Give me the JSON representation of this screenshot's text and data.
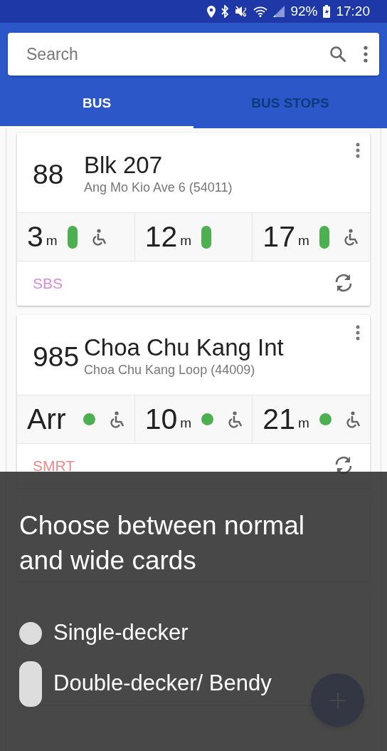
{
  "status_bar": {
    "battery": "92%",
    "time": "17:20"
  },
  "search": {
    "placeholder": "Search"
  },
  "tabs": [
    {
      "label": "BUS",
      "selected": true
    },
    {
      "label": "BUS STOPS",
      "selected": false
    }
  ],
  "cards": [
    {
      "route": "88",
      "destination": "Blk 207",
      "stop": "Ang Mo Kio Ave 6 (54011)",
      "operator": "SBS",
      "color": "#d68bdc",
      "arrivals": [
        {
          "value": "3",
          "unit": "m",
          "kind": "double",
          "wheelchair": true
        },
        {
          "value": "12",
          "unit": "m",
          "kind": "double",
          "wheelchair": false
        },
        {
          "value": "17",
          "unit": "m",
          "kind": "double",
          "wheelchair": true
        }
      ]
    },
    {
      "route": "985",
      "destination": "Choa Chu Kang Int",
      "stop": "Choa Chu Kang Loop (44009)",
      "operator": "SMRT",
      "color": "#f08a8a",
      "arrivals": [
        {
          "value": "Arr",
          "kind": "single",
          "wheelchair": true
        },
        {
          "value": "10",
          "unit": "m",
          "kind": "single",
          "wheelchair": true
        },
        {
          "value": "21",
          "unit": "m",
          "kind": "single",
          "wheelchair": true
        }
      ]
    }
  ],
  "overlay": {
    "title": "Choose between normal and wide cards",
    "options": [
      {
        "kind": "single",
        "label": "Single-decker"
      },
      {
        "kind": "double",
        "label": "Double-decker/ Bendy"
      }
    ]
  }
}
